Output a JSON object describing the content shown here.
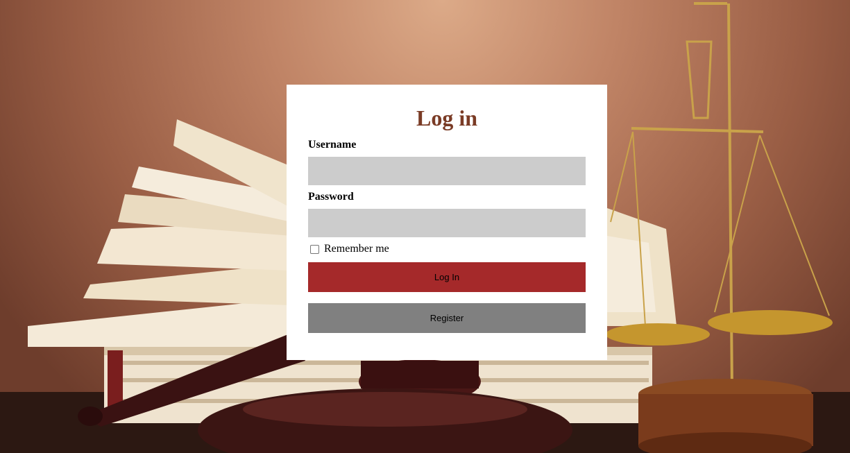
{
  "login_form": {
    "title": "Log in",
    "username_label": "Username",
    "username_value": "",
    "password_label": "Password",
    "password_value": "",
    "remember_label": "Remember me",
    "remember_checked": false,
    "login_button": "Log In",
    "register_button": "Register"
  },
  "colors": {
    "title": "#7a3b25",
    "login_button": "#a5292a",
    "register_button": "#808080",
    "field_background": "#cccccc",
    "card_background": "#ffffff"
  },
  "background": {
    "subject": "law books, gavel and scales of justice photo"
  }
}
